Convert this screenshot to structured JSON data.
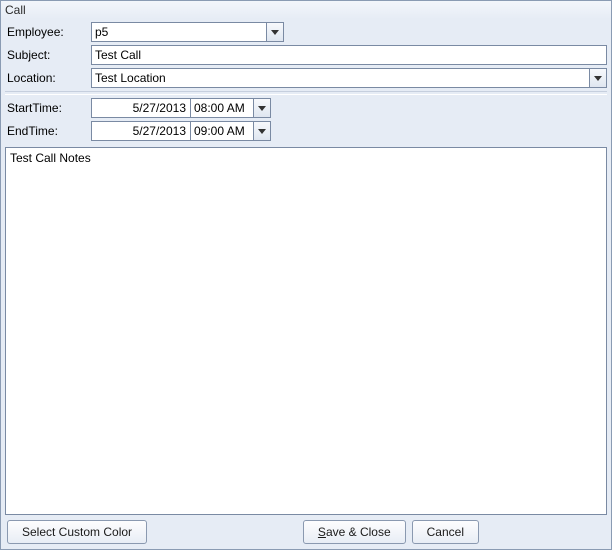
{
  "title": "Call",
  "labels": {
    "employee": "Employee:",
    "subject": "Subject:",
    "location": "Location:",
    "startTime": "StartTime:",
    "endTime": "EndTime:"
  },
  "values": {
    "employee": "p5",
    "subject": "Test Call",
    "location": "Test Location",
    "startDate": "5/27/2013",
    "startTime": "08:00 AM",
    "endDate": "5/27/2013",
    "endTime": "09:00 AM",
    "notes": "Test Call Notes"
  },
  "buttons": {
    "selectColor": "Select Custom Color",
    "saveClose": "Save & Close",
    "cancel": "Cancel"
  }
}
